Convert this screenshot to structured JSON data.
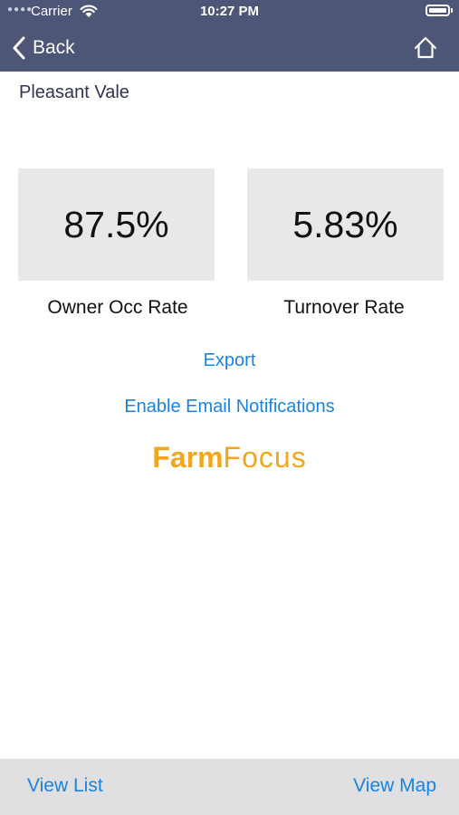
{
  "status_bar": {
    "carrier": "Carrier",
    "time": "10:27 PM"
  },
  "nav": {
    "back_label": "Back",
    "back_icon": "chevron-left-icon",
    "home_icon": "home-icon"
  },
  "area_title": "Pleasant Vale",
  "stats": [
    {
      "value": "87.5%",
      "label": "Owner Occ Rate"
    },
    {
      "value": "5.83%",
      "label": "Turnover Rate"
    }
  ],
  "actions": {
    "export_label": "Export",
    "email_label": "Enable Email Notifications"
  },
  "logo": {
    "part1": "Farm",
    "part2": "Focus"
  },
  "toolbar": {
    "view_list_label": "View List",
    "view_map_label": "View Map"
  },
  "colors": {
    "nav_bar": "#4d5676",
    "link": "#1a82e0",
    "stat_box": "#e8e8e8",
    "logo": "#f3a61c",
    "toolbar": "#e0e0e3"
  }
}
